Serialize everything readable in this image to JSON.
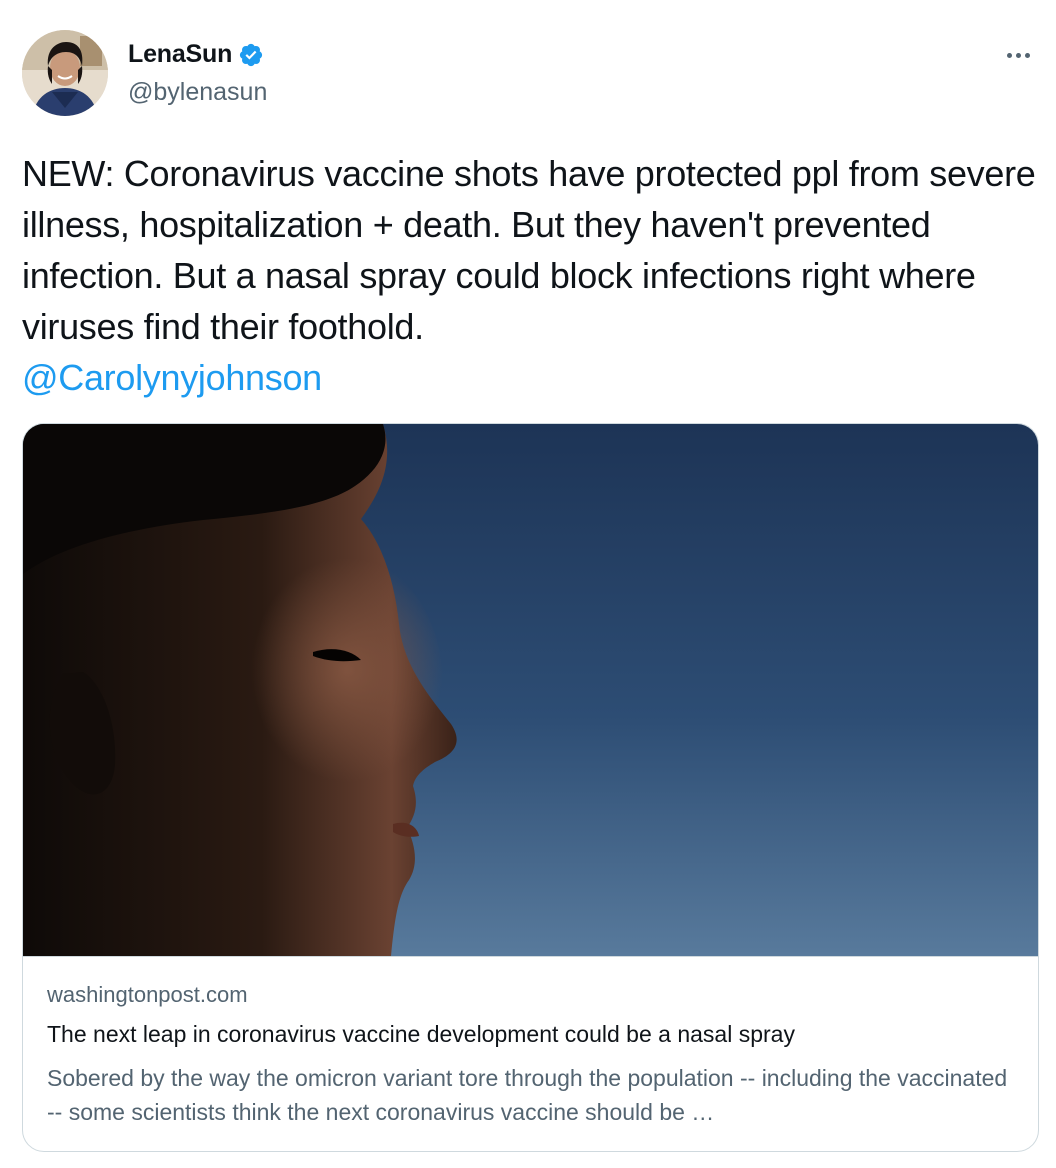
{
  "author": {
    "name": "LenaSun",
    "handle": "@bylenasun",
    "verified": true,
    "verified_icon": "verified-badge-icon",
    "avatar_icon": "profile-photo"
  },
  "more_icon": "more-horizontal-icon",
  "tweet": {
    "text": "NEW: Coronavirus vaccine shots have protected ppl from severe illness, hospitalization + death. But they haven't prevented infection. But a nasal spray could block infections right where viruses find their foothold.",
    "mention": "@Carolynyjohnson"
  },
  "card": {
    "image_icon": "article-photo",
    "domain": "washingtonpost.com",
    "title": "The next leap in coronavirus vaccine development could be a nasal spray",
    "description": "Sobered by the way the omicron variant tore through the population -- including the vaccinated -- some scientists think the next coronavirus vaccine should be …"
  },
  "colors": {
    "link": "#1d9bf0",
    "secondary_text": "#536471",
    "primary_text": "#0f1419",
    "border": "#cfd9de"
  }
}
